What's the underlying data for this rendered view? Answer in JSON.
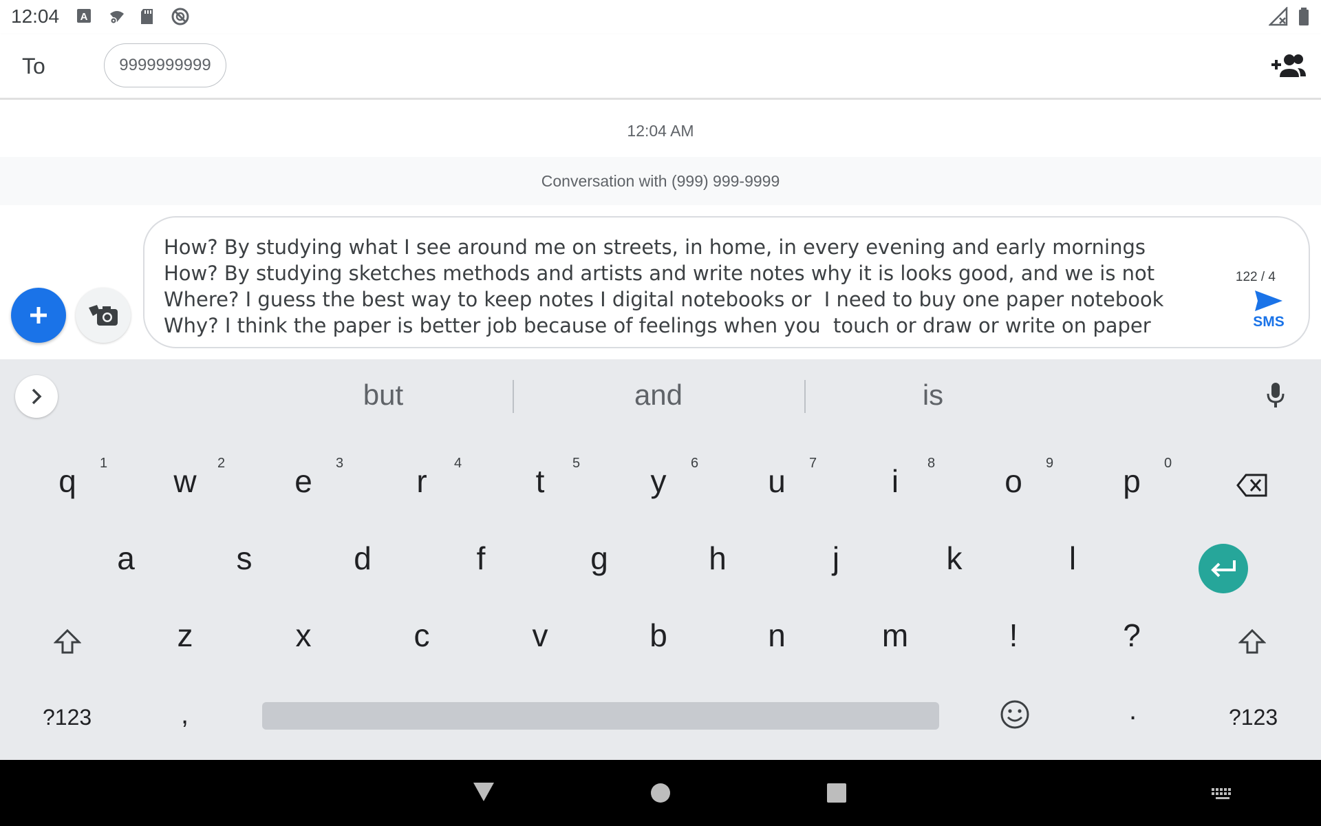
{
  "status_bar": {
    "time": "12:04"
  },
  "recipient": {
    "to_label": "To",
    "chip_text": "9999999999"
  },
  "conversation": {
    "timestamp": "12:04 AM",
    "banner": "Conversation with (999) 999-9999"
  },
  "compose": {
    "lines": [
      "How? By studying what I see around me on streets, in home, in every evening and early mornings",
      "How? By studying sketches methods and artists and write notes why it is looks good, and we is not",
      "Where? I guess the best way to keep notes I digital notebooks or  I need to buy one paper notebook",
      "Why? I think the paper is better job because of feelings when you  touch or draw or write on paper"
    ],
    "char_count": "122 / 4",
    "send_label": "SMS"
  },
  "suggestions": [
    "but",
    "and",
    "is"
  ],
  "keyboard": {
    "row1": [
      {
        "key": "q",
        "hint": "1"
      },
      {
        "key": "w",
        "hint": "2"
      },
      {
        "key": "e",
        "hint": "3"
      },
      {
        "key": "r",
        "hint": "4"
      },
      {
        "key": "t",
        "hint": "5"
      },
      {
        "key": "y",
        "hint": "6"
      },
      {
        "key": "u",
        "hint": "7"
      },
      {
        "key": "i",
        "hint": "8"
      },
      {
        "key": "o",
        "hint": "9"
      },
      {
        "key": "p",
        "hint": "0"
      }
    ],
    "row2": [
      "a",
      "s",
      "d",
      "f",
      "g",
      "h",
      "j",
      "k",
      "l"
    ],
    "row3": [
      "z",
      "x",
      "c",
      "v",
      "b",
      "n",
      "m",
      "!",
      "?"
    ],
    "symbols_label": "?123",
    "comma": ",",
    "period": "."
  },
  "colors": {
    "accent": "#1a73e8",
    "enter": "#26a69a",
    "keyboard_bg": "#e8eaed"
  }
}
